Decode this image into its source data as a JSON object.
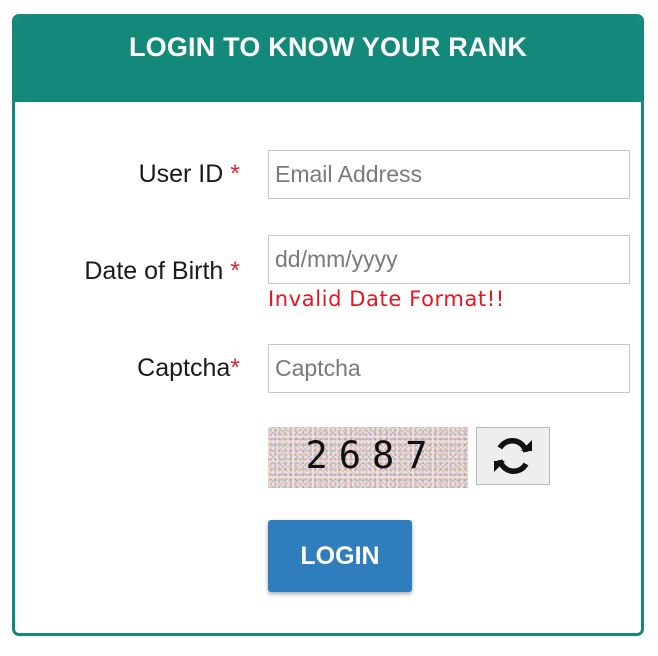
{
  "header": {
    "title": "LOGIN TO KNOW YOUR RANK"
  },
  "form": {
    "user_id": {
      "label": "User ID",
      "required_mark": "*",
      "placeholder": "Email Address",
      "value": ""
    },
    "dob": {
      "label": "Date of Birth",
      "required_mark": "*",
      "placeholder": "dd/mm/yyyy",
      "value": "",
      "error": "Invalid Date Format!!"
    },
    "captcha": {
      "label": "Captcha",
      "required_mark": "*",
      "placeholder": "Captcha",
      "value": "",
      "code": "2687"
    },
    "refresh_icon": "refresh-icon",
    "login_label": "LOGIN"
  },
  "colors": {
    "header": "#13897a",
    "required": "#e0242d",
    "error": "#e8141e",
    "login_button": "#2f7dbd"
  }
}
